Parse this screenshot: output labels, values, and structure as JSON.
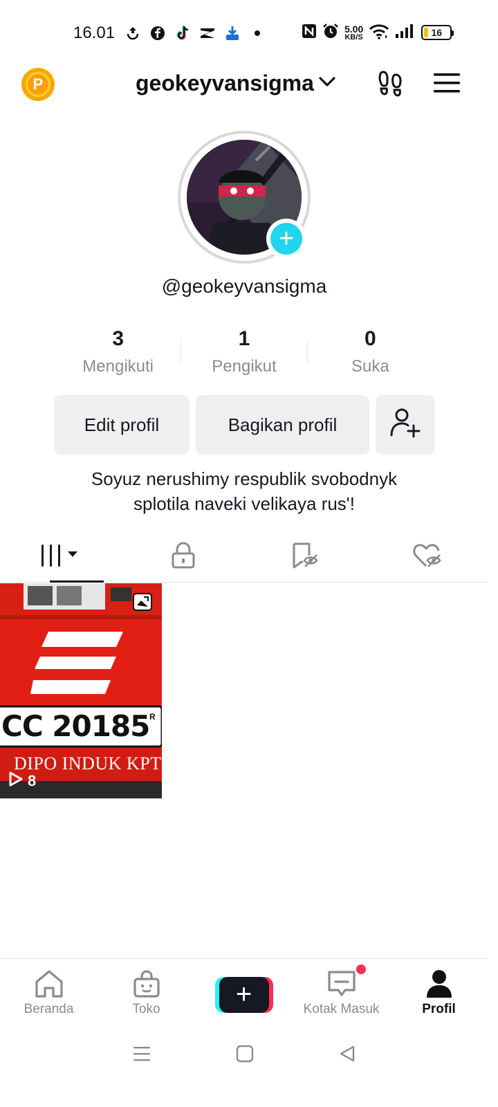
{
  "status_bar": {
    "time": "16.01",
    "net_speed_value": "5.00",
    "net_speed_unit": "KB/S",
    "battery_level": "16",
    "app_icons": [
      "sync-icon",
      "facebook-icon",
      "tiktok-icon",
      "capcut-icon",
      "download-app-icon",
      "notification-dot-icon"
    ],
    "system_icons": [
      "nfc-icon",
      "alarm-icon",
      "wifi-icon",
      "signal-icon",
      "battery-icon"
    ]
  },
  "header": {
    "username": "geokeyvansigma",
    "coin_letter": "P"
  },
  "profile": {
    "handle": "@geokeyvansigma",
    "stats": [
      {
        "value": "3",
        "label": "Mengikuti"
      },
      {
        "value": "1",
        "label": "Pengikut"
      },
      {
        "value": "0",
        "label": "Suka"
      }
    ],
    "buttons": {
      "edit": "Edit profil",
      "share": "Bagikan profil"
    },
    "bio_line1": "Soyuz nerushimy respublik svobodnyk",
    "bio_line2": "splotila naveki velikaya rus'!"
  },
  "tabs": [
    {
      "name": "videos",
      "icon": "grid-icon",
      "active": true
    },
    {
      "name": "private",
      "icon": "lock-icon",
      "active": false
    },
    {
      "name": "saved",
      "icon": "bookmark-hidden-icon",
      "active": false
    },
    {
      "name": "liked",
      "icon": "heart-hidden-icon",
      "active": false
    }
  ],
  "videos": [
    {
      "plate_text": "CC 20185",
      "plate_mark": "R",
      "caption": "DIPO INDUK KPT",
      "views": "8"
    }
  ],
  "bottom_nav": [
    {
      "label": "Beranda",
      "icon": "home-icon"
    },
    {
      "label": "Toko",
      "icon": "shop-bag-icon"
    },
    {
      "label": "",
      "icon": "create-plus-icon"
    },
    {
      "label": "Kotak Masuk",
      "icon": "inbox-icon"
    },
    {
      "label": "Profil",
      "icon": "profile-icon"
    }
  ],
  "colors": {
    "accent_cyan": "#20d5ec",
    "accent_red": "#fe2c55",
    "text_primary": "#161823",
    "text_secondary": "#8a8b91",
    "video_bg": "#e21f14"
  }
}
